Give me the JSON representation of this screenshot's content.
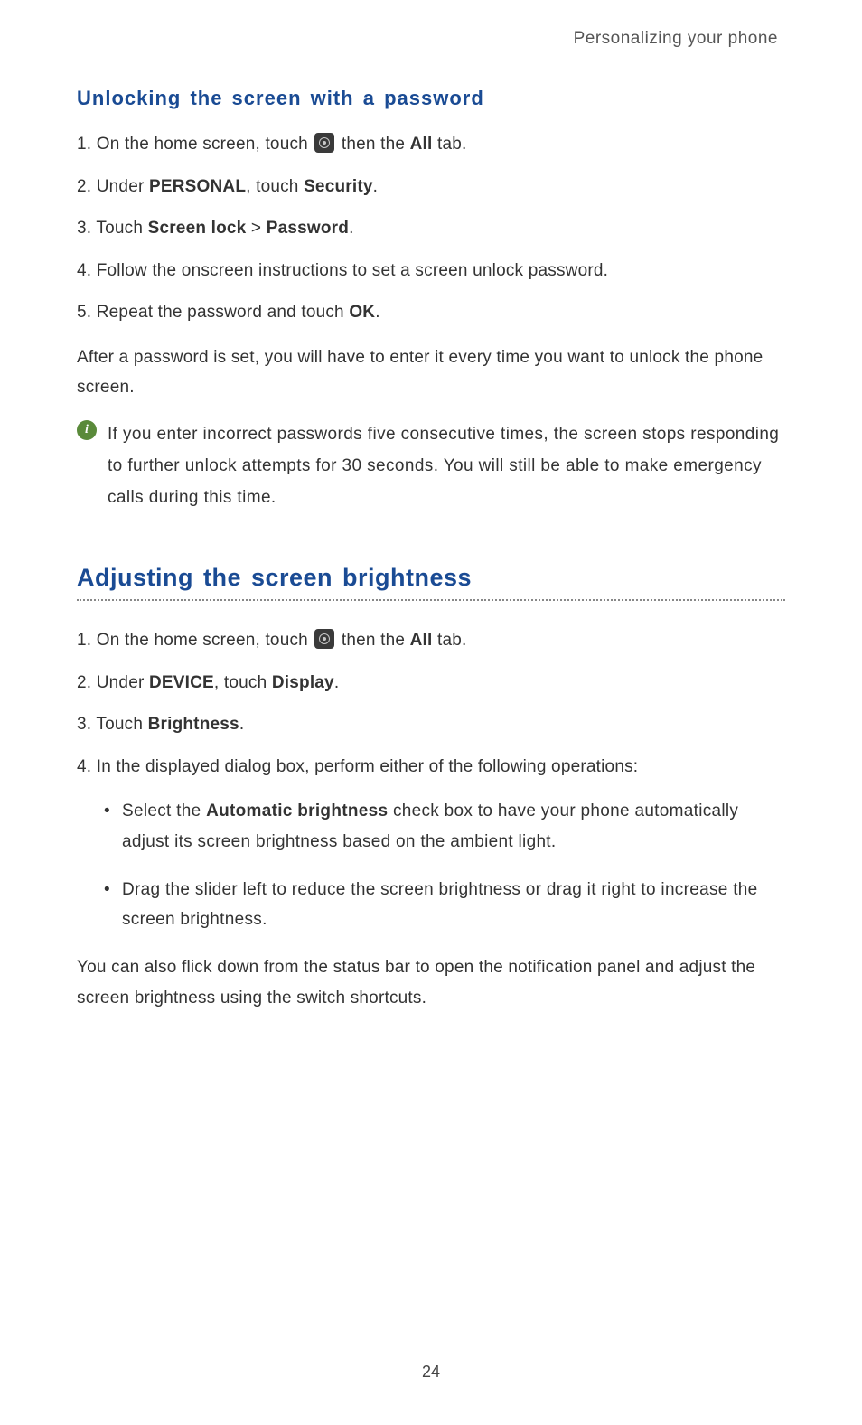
{
  "header": "Personalizing your phone",
  "section1": {
    "heading": "Unlocking the screen with a password",
    "steps": [
      {
        "num": "1.",
        "pre": "On the home screen, touch ",
        "post_pre": " then the ",
        "bold": "All",
        "post": " tab."
      },
      {
        "num": "2.",
        "pre": "Under ",
        "bold1": "PERSONAL",
        "mid": ", touch ",
        "bold2": "Security",
        "post": "."
      },
      {
        "num": "3.",
        "pre": "Touch ",
        "bold1": "Screen lock",
        "mid": " > ",
        "bold2": "Password",
        "post": "."
      },
      {
        "num": "4.",
        "text": "Follow the onscreen instructions to set a screen unlock password."
      },
      {
        "num": "5.",
        "pre": "Repeat the password and touch ",
        "bold": "OK",
        "post": "."
      }
    ],
    "after": "After a password is set, you will have to enter it every time you want to unlock the phone screen.",
    "note": "If you enter incorrect passwords five consecutive times, the screen stops responding to further unlock attempts for 30 seconds. You will still be able to make emergency calls during this time."
  },
  "section2": {
    "heading": "Adjusting the screen brightness",
    "steps": [
      {
        "num": "1.",
        "pre": "On the home screen, touch ",
        "post_pre": " then the ",
        "bold": "All",
        "post": " tab."
      },
      {
        "num": "2.",
        "pre": "Under ",
        "bold1": "DEVICE",
        "mid": ", touch ",
        "bold2": "Display",
        "post": "."
      },
      {
        "num": "3.",
        "pre": "Touch ",
        "bold": "Brightness",
        "post": "."
      },
      {
        "num": "4.",
        "text": "In the displayed dialog box, perform either of the following operations:"
      }
    ],
    "bullets": [
      {
        "pre": "Select the ",
        "bold": "Automatic brightness",
        "post": " check box to have your phone automatically adjust its screen brightness based on the ambient light."
      },
      {
        "text": "Drag the slider left to reduce the screen brightness or drag it right to increase the screen brightness."
      }
    ],
    "after": "You can also flick down from the status bar to open the notification panel and adjust the screen brightness using the switch shortcuts."
  },
  "page_number": "24",
  "info_glyph": "i"
}
